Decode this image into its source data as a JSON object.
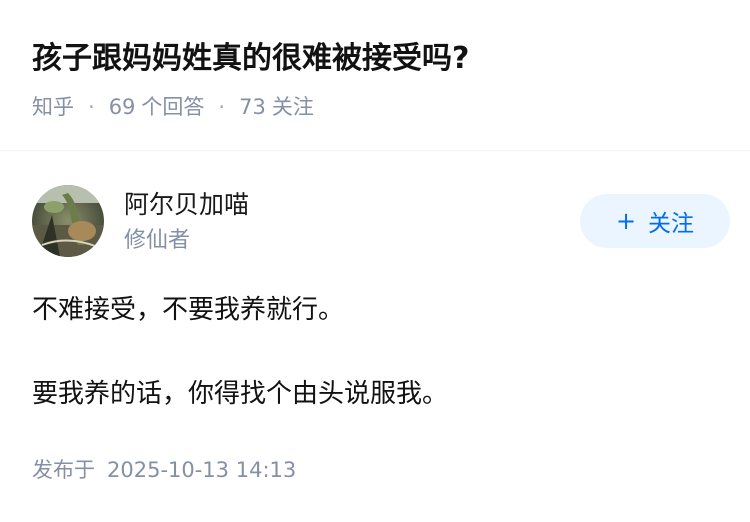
{
  "question": {
    "title": "孩子跟妈妈姓真的很难被接受吗?",
    "source": "知乎",
    "answers_count": "69",
    "answers_label": "个回答",
    "followers_count": "73",
    "followers_label": "关注"
  },
  "answer": {
    "author": {
      "name": "阿尔贝加喵",
      "badge": "修仙者",
      "avatar_icon": "avatar-photo"
    },
    "follow_button": {
      "icon": "+",
      "label": "关注"
    },
    "paragraphs": [
      "不难接受，不要我养就行。",
      "要我养的话，你得找个由头说服我。"
    ],
    "published_label": "发布于",
    "published_time": "2025-10-13 14:13"
  },
  "colors": {
    "title": "#121212",
    "meta": "#8590a6",
    "accent": "#056de8",
    "follow_bg": "#ebf5ff"
  }
}
